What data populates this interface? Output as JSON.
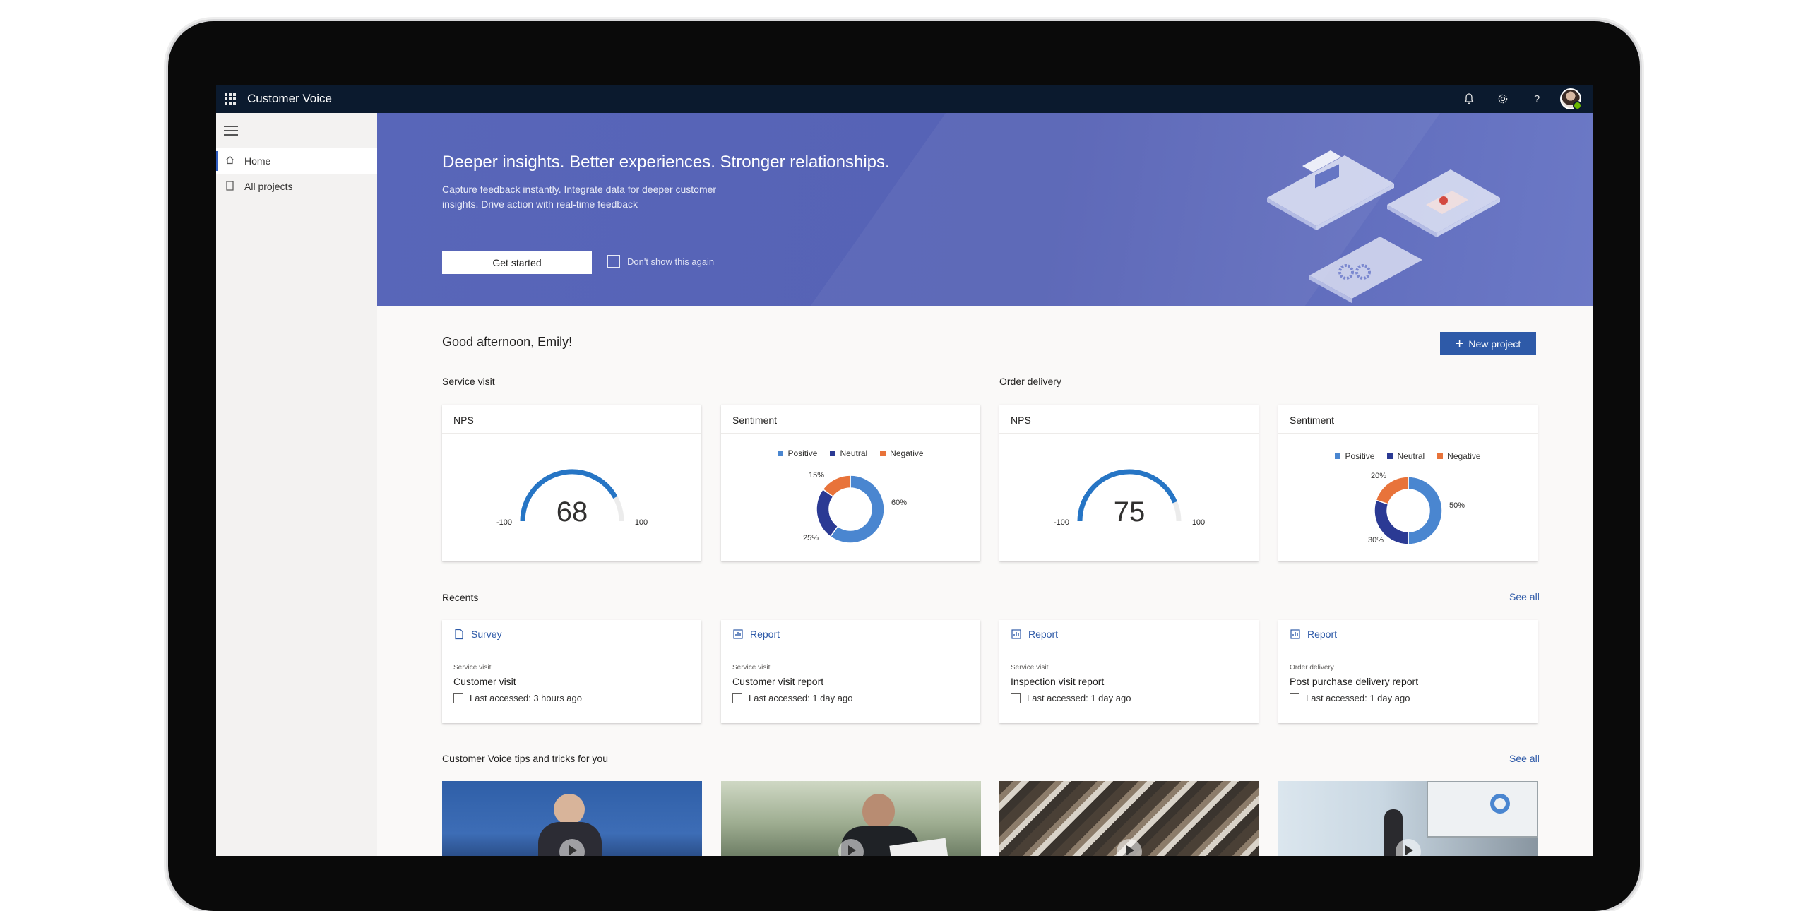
{
  "app": {
    "name": "Customer Voice"
  },
  "topbar": {
    "icons": [
      "bell-icon",
      "gear-icon",
      "help-icon"
    ],
    "help_glyph": "?"
  },
  "sidebar": {
    "items": [
      {
        "label": "Home",
        "icon": "home-icon",
        "active": true
      },
      {
        "label": "All projects",
        "icon": "document-icon",
        "active": false
      }
    ]
  },
  "hero": {
    "title": "Deeper insights. Better experiences. Stronger relationships.",
    "subtitle": "Capture feedback instantly. Integrate data for deeper customer insights. Drive action with real-time feedback",
    "cta_label": "Get started",
    "checkbox_label": "Don't show this again"
  },
  "main": {
    "greeting": "Good afternoon, Emily!",
    "new_project_label": "New project",
    "groups": [
      {
        "label": "Service visit",
        "nps": {
          "title": "NPS",
          "value": "68",
          "min": "-100",
          "max": "100"
        },
        "sentiment": {
          "title": "Sentiment",
          "positive": 60,
          "neutral": 25,
          "negative": 15,
          "positive_label": "60%",
          "neutral_label": "25%",
          "negative_label": "15%"
        }
      },
      {
        "label": "Order delivery",
        "nps": {
          "title": "NPS",
          "value": "75",
          "min": "-100",
          "max": "100"
        },
        "sentiment": {
          "title": "Sentiment",
          "positive": 50,
          "neutral": 30,
          "negative": 20,
          "positive_label": "50%",
          "neutral_label": "30%",
          "negative_label": "20%"
        }
      }
    ],
    "legend": {
      "positive": "Positive",
      "neutral": "Neutral",
      "negative": "Negative"
    },
    "colors": {
      "positive": "#4a86d0",
      "neutral": "#2b3a94",
      "negative": "#e8733a",
      "gauge": "#2675c5",
      "accent": "#2e5aa8"
    },
    "recents": {
      "title": "Recents",
      "see_all": "See all",
      "items": [
        {
          "type": "Survey",
          "context": "Service visit",
          "name": "Customer visit",
          "accessed": "Last accessed: 3 hours ago"
        },
        {
          "type": "Report",
          "context": "Service visit",
          "name": "Customer visit report",
          "accessed": "Last accessed: 1 day ago"
        },
        {
          "type": "Report",
          "context": "Service visit",
          "name": "Inspection visit report",
          "accessed": "Last accessed: 1 day ago"
        },
        {
          "type": "Report",
          "context": "Order delivery",
          "name": "Post purchase delivery report",
          "accessed": "Last accessed: 1 day ago"
        }
      ]
    },
    "tips": {
      "title": "Customer Voice tips and tricks for you",
      "see_all": "See all"
    }
  }
}
